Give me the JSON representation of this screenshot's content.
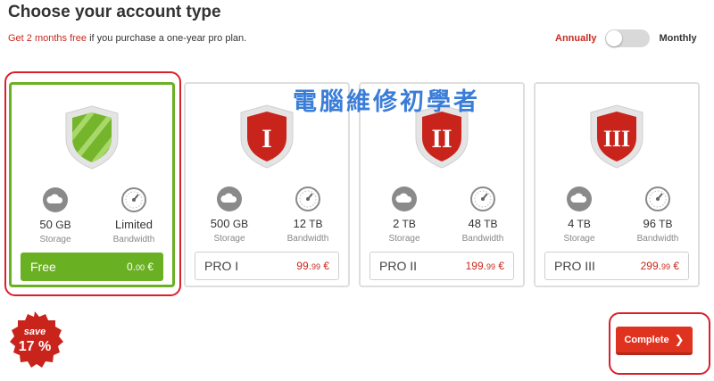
{
  "header": {
    "title": "Choose your account type",
    "promo": "Get 2 months free",
    "promo_rest": " if you purchase a one-year pro plan."
  },
  "billing": {
    "annually_label": "Annually",
    "monthly_label": "Monthly",
    "selected": "Annually"
  },
  "watermark": "電腦維修初學者",
  "plans": [
    {
      "name": "Free",
      "shield_roman": "",
      "storage_value": "50",
      "storage_unit": "GB",
      "storage_label": "Storage",
      "bandwidth_value": "Limited",
      "bandwidth_unit": "",
      "bandwidth_label": "Bandwidth",
      "price_main": "0.",
      "price_cents": "00",
      "currency": " €",
      "selected": true
    },
    {
      "name": "PRO I",
      "shield_roman": "I",
      "storage_value": "500",
      "storage_unit": "GB",
      "storage_label": "Storage",
      "bandwidth_value": "12",
      "bandwidth_unit": "TB",
      "bandwidth_label": "Bandwidth",
      "price_main": "99.",
      "price_cents": "99",
      "currency": " €",
      "selected": false
    },
    {
      "name": "PRO II",
      "shield_roman": "II",
      "storage_value": "2",
      "storage_unit": "TB",
      "storage_label": "Storage",
      "bandwidth_value": "48",
      "bandwidth_unit": "TB",
      "bandwidth_label": "Bandwidth",
      "price_main": "199.",
      "price_cents": "99",
      "currency": " €",
      "selected": false
    },
    {
      "name": "PRO III",
      "shield_roman": "III",
      "storage_value": "4",
      "storage_unit": "TB",
      "storage_label": "Storage",
      "bandwidth_value": "96",
      "bandwidth_unit": "TB",
      "bandwidth_label": "Bandwidth",
      "price_main": "299.",
      "price_cents": "99",
      "currency": " €",
      "selected": false
    }
  ],
  "save_badge": {
    "line1": "save",
    "line2": "17 %"
  },
  "complete_button": {
    "label": "Complete"
  },
  "colors": {
    "accent_red": "#c62a1f",
    "selected_green": "#6ab023",
    "highlight_frame": "#d8202a"
  }
}
